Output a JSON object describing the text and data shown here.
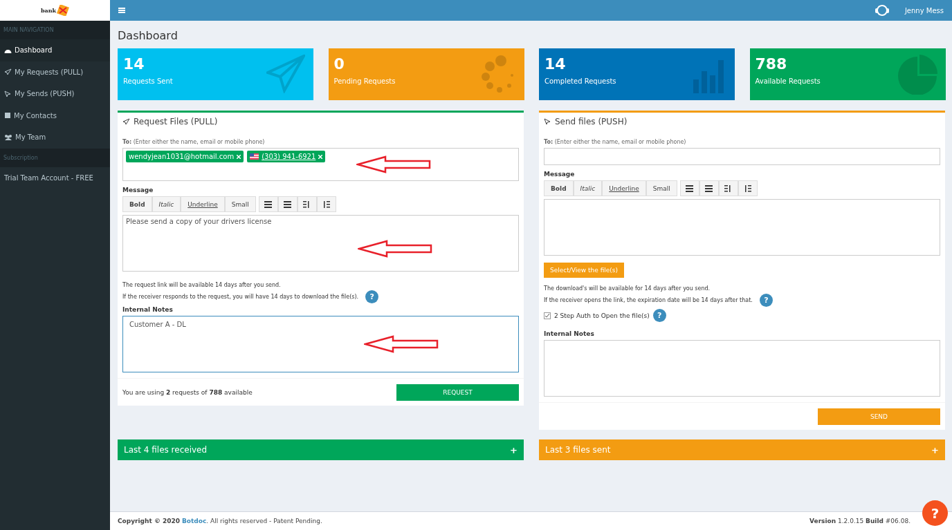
{
  "logo": {
    "text": "bank"
  },
  "topbar": {
    "user": "Jenny Mess"
  },
  "sidebar": {
    "sections": [
      {
        "header": "MAIN NAVIGATION",
        "items": [
          {
            "label": "Dashboard",
            "selected": true
          },
          {
            "label": "My Requests (PULL)",
            "selected": false
          },
          {
            "label": "My Sends (PUSH)",
            "selected": false
          },
          {
            "label": "My Contacts",
            "selected": false
          },
          {
            "label": "My Team",
            "selected": false
          }
        ]
      },
      {
        "header": "Subscription",
        "items": [
          {
            "label": "Trial Team Account - FREE",
            "selected": false
          }
        ]
      }
    ]
  },
  "page_title": "Dashboard",
  "stats": [
    {
      "value": "14",
      "label": "Requests Sent",
      "color": "#00c0ef"
    },
    {
      "value": "0",
      "label": "Pending Requests",
      "color": "#f39c12"
    },
    {
      "value": "14",
      "label": "Completed Requests",
      "color": "#0073b7"
    },
    {
      "value": "788",
      "label": "Available Requests",
      "color": "#00a65a"
    }
  ],
  "panels": [
    {
      "kind": "request",
      "title": "Request Files (PULL)",
      "color": "#00a65a",
      "to_label": "To:",
      "to_hint": "(Enter either the name, email or mobile phone)",
      "recipients": [
        {
          "text": "wendyjean1031@hotmail.com",
          "kind": "email"
        },
        {
          "text": "(303) 941-6921",
          "kind": "phone"
        }
      ],
      "message_label": "Message",
      "format_buttons": [
        "Bold",
        "Italic",
        "Underline",
        "Small"
      ],
      "message": "Please send a copy of your drivers license",
      "notes": [
        "The request link will be available 14 days after you send.",
        "If the receiver responds to the request, you will have 14 days to download the file(s)."
      ],
      "notes_help": "?",
      "internal_notes_label": "Internal Notes",
      "internal_notes": "Customer A - DL",
      "usage": "You are using **2** requests of **788** available",
      "action": "REQUEST"
    },
    {
      "kind": "send",
      "title": "Send files (PUSH)",
      "color": "#f39c12",
      "to_label": "To:",
      "to_hint": "(Enter either the name, email or mobile phone)",
      "message_label": "Message",
      "format_buttons": [
        "Bold",
        "Italic",
        "Underline",
        "Small"
      ],
      "select_button": "Select/View the file(s)",
      "notes": [
        "The download's will be available for 14 days after you send.",
        "If the receiver opens the link, the expiration date will be 14 days after that."
      ],
      "notes_help": "?",
      "two_step": {
        "label": "2 Step Auth to Open the file(s)",
        "checked": true,
        "help": "?"
      },
      "internal_notes_label": "Internal Notes",
      "action": "SEND"
    }
  ],
  "collapsibles": [
    {
      "title": "Last 4 files received",
      "color": "#00a65a",
      "symbol": "+"
    },
    {
      "title": "Last 3 files sent",
      "color": "#f39c12",
      "symbol": "+"
    }
  ],
  "footer": {
    "prefix": "Copyright © 2020",
    "link": "Botdoc",
    "suffix": ". All rights reserved - Patent Pending.",
    "version": "**Version** 1.2.0.15 **Build** #06.08.",
    "help": "?"
  }
}
